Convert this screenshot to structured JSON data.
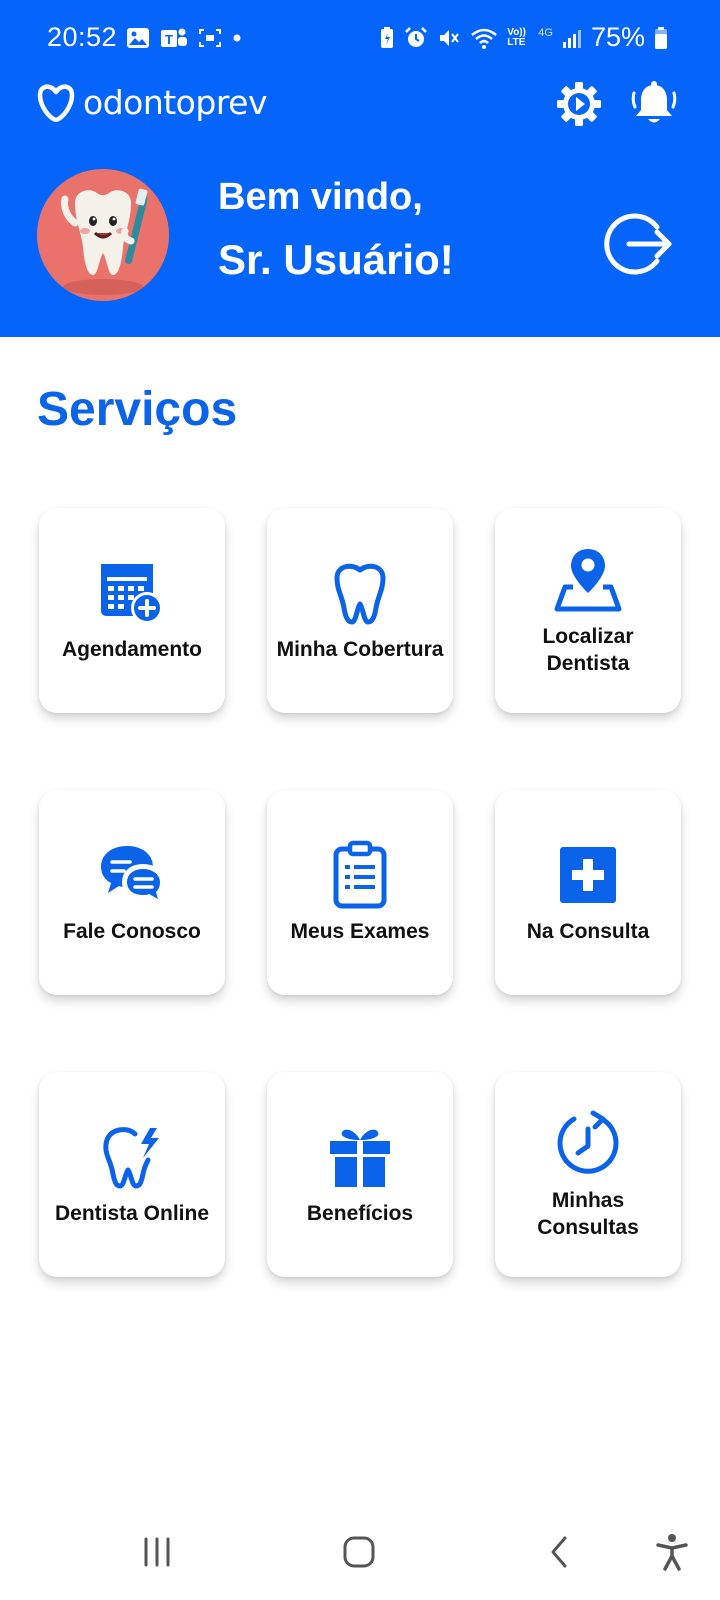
{
  "colors": {
    "brand_blue": "#0565fb",
    "title_blue": "#0a63e8",
    "card_bg": "#ffffff",
    "text_dark": "#111111"
  },
  "status_bar": {
    "time": "20:52",
    "battery_percent": "75%",
    "left_icons": [
      "gallery-icon",
      "teams-icon",
      "screen-record-icon",
      "dot-icon"
    ],
    "right_icons": [
      "battery-saver-icon",
      "alarm-icon",
      "mute-icon",
      "wifi-icon",
      "volte-icon",
      "4g-icon",
      "signal-icon",
      "battery-icon"
    ],
    "volte_text": "Vo)) LTE",
    "network_text": "4G"
  },
  "header": {
    "logo_text": "odontoprev",
    "greeting_line1": "Bem vindo,",
    "greeting_line2": "Sr. Usuário!"
  },
  "services": {
    "title": "Serviços",
    "items": [
      {
        "label": "Agendamento",
        "icon": "calendar-add-icon"
      },
      {
        "label": "Minha Cobertura",
        "icon": "tooth-icon"
      },
      {
        "label": "Localizar\nDentista",
        "icon": "map-pin-icon"
      },
      {
        "label": "Fale Conosco",
        "icon": "chat-icon"
      },
      {
        "label": "Meus Exames",
        "icon": "clipboard-icon"
      },
      {
        "label": "Na Consulta",
        "icon": "medical-cross-icon"
      },
      {
        "label": "Dentista Online",
        "icon": "tooth-online-icon"
      },
      {
        "label": "Benefícios",
        "icon": "gift-icon"
      },
      {
        "label": "Minhas\nConsultas",
        "icon": "clock-history-icon"
      }
    ]
  },
  "navbar": {
    "buttons": [
      "recent-apps-icon",
      "home-icon",
      "back-icon",
      "accessibility-icon"
    ]
  }
}
